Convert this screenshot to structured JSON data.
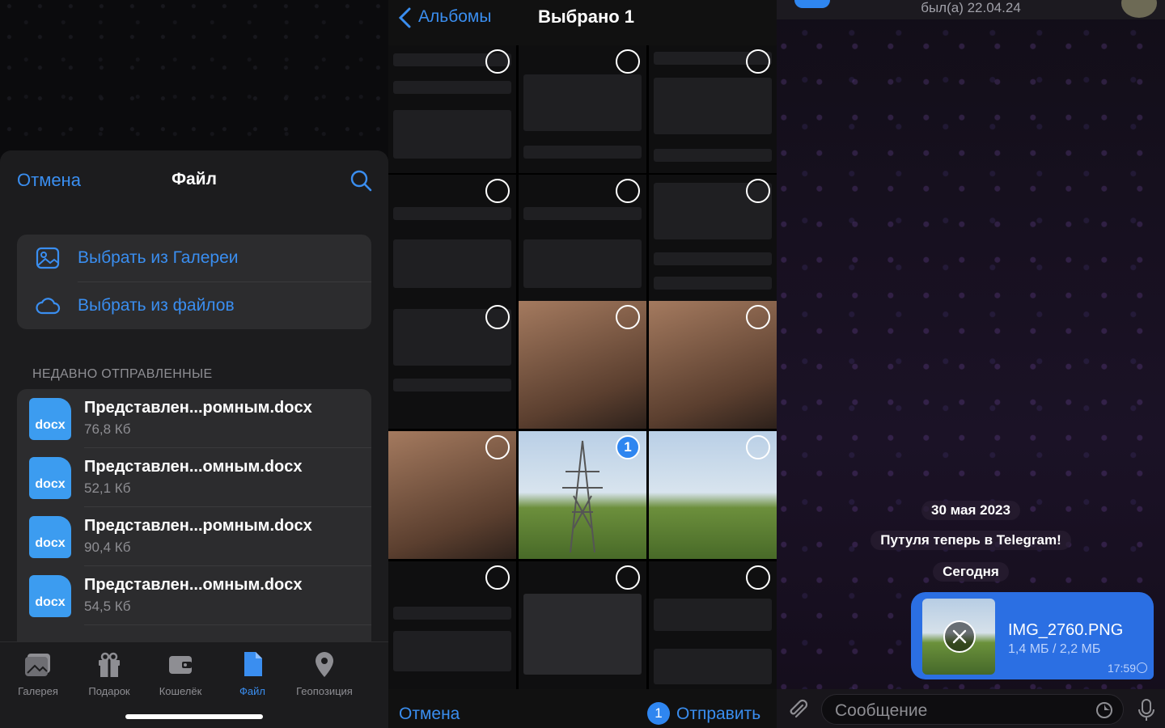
{
  "file_sheet": {
    "cancel_label": "Отмена",
    "title": "Файл",
    "options": [
      {
        "label": "Выбрать из Галереи",
        "icon": "gallery-icon"
      },
      {
        "label": "Выбрать из файлов",
        "icon": "cloud-icon"
      }
    ],
    "recent_header": "НЕДАВНО ОТПРАВЛЕННЫЕ",
    "recent_files": [
      {
        "name": "Представлен...ромным.docx",
        "size": "76,8 Кб",
        "type": "docx"
      },
      {
        "name": "Представлен...омным.docx",
        "size": "52,1 Кб",
        "type": "docx"
      },
      {
        "name": "Представлен...ромным.docx",
        "size": "90,4 Кб",
        "type": "docx"
      },
      {
        "name": "Представлен...омным.docx",
        "size": "54,5 Кб",
        "type": "docx"
      }
    ],
    "tabs": [
      {
        "label": "Галерея",
        "icon": "gallery-icon"
      },
      {
        "label": "Подарок",
        "icon": "gift-icon"
      },
      {
        "label": "Кошелёк",
        "icon": "wallet-icon"
      },
      {
        "label": "Файл",
        "icon": "file-icon"
      },
      {
        "label": "Геопозиция",
        "icon": "location-pin-icon"
      }
    ]
  },
  "photo_picker": {
    "back_label": "Альбомы",
    "title": "Выбрано 1",
    "selected_badge": "1",
    "cancel_label": "Отмена",
    "send_label": "Отправить",
    "send_count": "1"
  },
  "chat": {
    "last_seen": "был(а) 22.04.24",
    "date_pill": "30 мая 2023",
    "service_message": "Путуля теперь в Telegram!",
    "today_pill": "Сегодня",
    "message": {
      "file_name": "IMG_2760.PNG",
      "progress": "1,4 МБ / 2,2 МБ",
      "time": "17:59"
    },
    "input_placeholder": "Сообщение"
  }
}
